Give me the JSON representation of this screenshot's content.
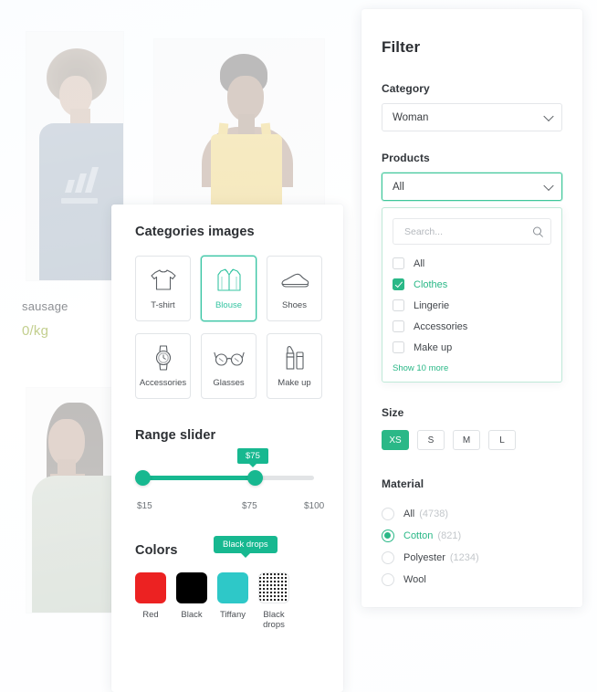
{
  "background_products": {
    "caption": "sausage",
    "price": "0/kg",
    "photos": [
      {
        "alt": "person-in-blue-adidas-tee"
      },
      {
        "alt": "woman-in-yellow-tank-top"
      },
      {
        "alt": "woman-in-sage-green-tee"
      }
    ]
  },
  "filter": {
    "title": "Filter",
    "category": {
      "label": "Category",
      "value": "Woman",
      "chevron_icon": "chevron-down-icon"
    },
    "products": {
      "label": "Products",
      "value": "All",
      "chevron_icon": "chevron-down-icon",
      "dropdown": {
        "search_placeholder": "Search...",
        "search_value": "",
        "search_icon": "search-icon",
        "options": [
          {
            "label": "All",
            "checked": false
          },
          {
            "label": "Clothes",
            "checked": true
          },
          {
            "label": "Lingerie",
            "checked": false
          },
          {
            "label": "Accessories",
            "checked": false
          },
          {
            "label": "Make up",
            "checked": false
          }
        ],
        "show_more": "Show 10 more"
      }
    },
    "size": {
      "label": "Size",
      "options": [
        {
          "label": "XS",
          "active": true
        },
        {
          "label": "S",
          "active": false
        },
        {
          "label": "M",
          "active": false
        },
        {
          "label": "L",
          "active": false
        }
      ]
    },
    "material": {
      "label": "Material",
      "options": [
        {
          "label": "All",
          "count": "(4738)",
          "selected": false
        },
        {
          "label": "Cotton",
          "count": "(821)",
          "selected": true
        },
        {
          "label": "Polyester",
          "count": "(1234)",
          "selected": false
        },
        {
          "label": "Wool",
          "count": "",
          "selected": false
        }
      ]
    }
  },
  "kit": {
    "categories": {
      "title": "Categories images",
      "tiles": [
        {
          "label": "T-shirt",
          "icon": "tshirt-icon",
          "active": false
        },
        {
          "label": "Blouse",
          "icon": "blouse-icon",
          "active": true
        },
        {
          "label": "Shoes",
          "icon": "shoe-icon",
          "active": false
        },
        {
          "label": "Accessories",
          "icon": "watch-icon",
          "active": false
        },
        {
          "label": "Glasses",
          "icon": "glasses-icon",
          "active": false
        },
        {
          "label": "Make up",
          "icon": "lipstick-icon",
          "active": false
        }
      ]
    },
    "range_slider": {
      "title": "Range slider",
      "min_label": "$15",
      "mid_label": "$75",
      "max_label": "$100",
      "bubble": "$75"
    },
    "colors": {
      "title": "Colors",
      "tooltip": "Black drops",
      "swatches": [
        {
          "label": "Red",
          "hex": "#ec2222",
          "pattern": false
        },
        {
          "label": "Black",
          "hex": "#000000",
          "pattern": false
        },
        {
          "label": "Tiffany",
          "hex": "#2ec8c8",
          "pattern": false
        },
        {
          "label": "Black drops",
          "hex": "#ffffff",
          "pattern": true
        }
      ]
    }
  },
  "theme": {
    "accent": "#2ab887",
    "accent_alt": "#17b890",
    "text": "#2c2f33"
  }
}
